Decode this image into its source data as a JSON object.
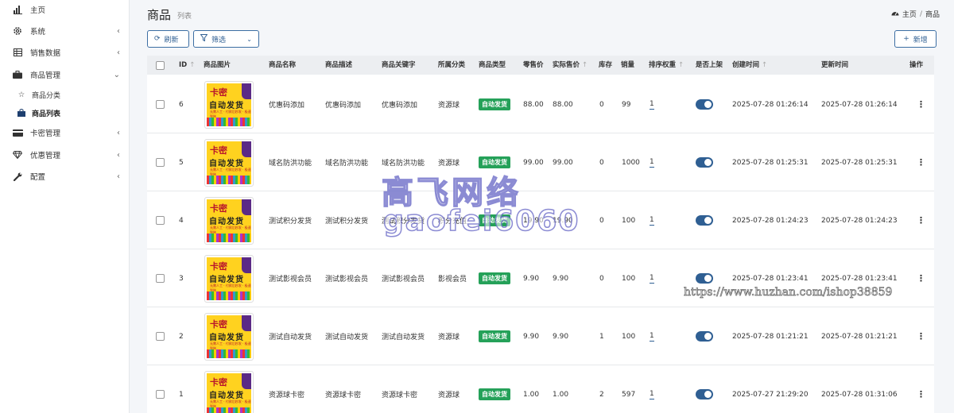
{
  "sidebar": {
    "items": [
      {
        "label": "主页",
        "icon": "bar-chart-icon",
        "has_children": false
      },
      {
        "label": "系统",
        "icon": "gear-icon",
        "has_children": true
      },
      {
        "label": "销售数据",
        "icon": "table-icon",
        "has_children": true
      },
      {
        "label": "商品管理",
        "icon": "briefcase-icon",
        "has_children": true,
        "expanded": true,
        "children": [
          {
            "label": "商品分类",
            "icon": "star-icon",
            "active": false
          },
          {
            "label": "商品列表",
            "icon": "bag-icon",
            "active": true
          }
        ]
      },
      {
        "label": "卡密管理",
        "icon": "credit-card-icon",
        "has_children": true
      },
      {
        "label": "优惠管理",
        "icon": "diamond-icon",
        "has_children": true
      },
      {
        "label": "配置",
        "icon": "wrench-icon",
        "has_children": true
      }
    ]
  },
  "header": {
    "title": "商品",
    "subtitle": "列表",
    "breadcrumb": {
      "home": "主页",
      "current": "商品"
    }
  },
  "toolbar": {
    "refresh_label": "刷新",
    "filter_label": "筛选",
    "add_label": "新增"
  },
  "table": {
    "columns": {
      "id": "ID",
      "image": "商品图片",
      "name": "商品名称",
      "desc": "商品描述",
      "keyword": "商品关键字",
      "category": "所属分类",
      "type": "商品类型",
      "retail": "零售价",
      "actual": "实际售价",
      "stock": "库存",
      "sales": "销量",
      "weight": "排序权重",
      "listed": "是否上架",
      "created": "创建时间",
      "updated": "更新时间",
      "actions": "操作"
    },
    "thumb": {
      "line1": "卡密",
      "line2": "自动发货",
      "line3": "无需人工 · 付款后秒发 · 极速到账"
    },
    "rows": [
      {
        "id": "6",
        "name": "优惠码添加",
        "desc": "优惠码添加",
        "keyword": "优惠码添加",
        "category": "资源球",
        "type": "自动发货",
        "retail": "88.00",
        "actual": "88.00",
        "stock": "0",
        "sales": "99",
        "weight": "1",
        "created": "2025-07-28 01:26:14",
        "updated": "2025-07-28 01:26:14"
      },
      {
        "id": "5",
        "name": "域名防洪功能",
        "desc": "域名防洪功能",
        "keyword": "域名防洪功能",
        "category": "资源球",
        "type": "自动发货",
        "retail": "99.00",
        "actual": "99.00",
        "stock": "0",
        "sales": "1000",
        "weight": "1",
        "created": "2025-07-28 01:25:31",
        "updated": "2025-07-28 01:25:31"
      },
      {
        "id": "4",
        "name": "测试积分发货",
        "desc": "测试积分发货",
        "keyword": "测试积分发货",
        "category": "积分充值",
        "type": "自动发货",
        "retail": "19.90",
        "actual": "19.90",
        "stock": "0",
        "sales": "100",
        "weight": "1",
        "created": "2025-07-28 01:24:23",
        "updated": "2025-07-28 01:24:23"
      },
      {
        "id": "3",
        "name": "测试影视会员",
        "desc": "测试影视会员",
        "keyword": "测试影视会员",
        "category": "影视会员",
        "type": "自动发货",
        "retail": "9.90",
        "actual": "9.90",
        "stock": "0",
        "sales": "100",
        "weight": "1",
        "created": "2025-07-28 01:23:41",
        "updated": "2025-07-28 01:23:41"
      },
      {
        "id": "2",
        "name": "测试自动发货",
        "desc": "测试自动发货",
        "keyword": "测试自动发货",
        "category": "资源球",
        "type": "自动发货",
        "retail": "9.90",
        "actual": "9.90",
        "stock": "1",
        "sales": "100",
        "weight": "1",
        "created": "2025-07-28 01:21:21",
        "updated": "2025-07-28 01:21:21"
      },
      {
        "id": "1",
        "name": "资源球卡密",
        "desc": "资源球卡密",
        "keyword": "资源球卡密",
        "category": "资源球",
        "type": "自动发货",
        "retail": "1.00",
        "actual": "1.00",
        "stock": "2",
        "sales": "597",
        "weight": "1",
        "created": "2025-07-27 21:29:20",
        "updated": "2025-07-28 01:31:06"
      }
    ]
  },
  "watermarks": {
    "line1": "高飞网络",
    "line2": "gaofei6060",
    "url": "https://www.huzhan.com/ishop38859"
  },
  "colors": {
    "accent": "#2f5f93",
    "badge": "#25a159",
    "header_bg": "#eceef1"
  }
}
